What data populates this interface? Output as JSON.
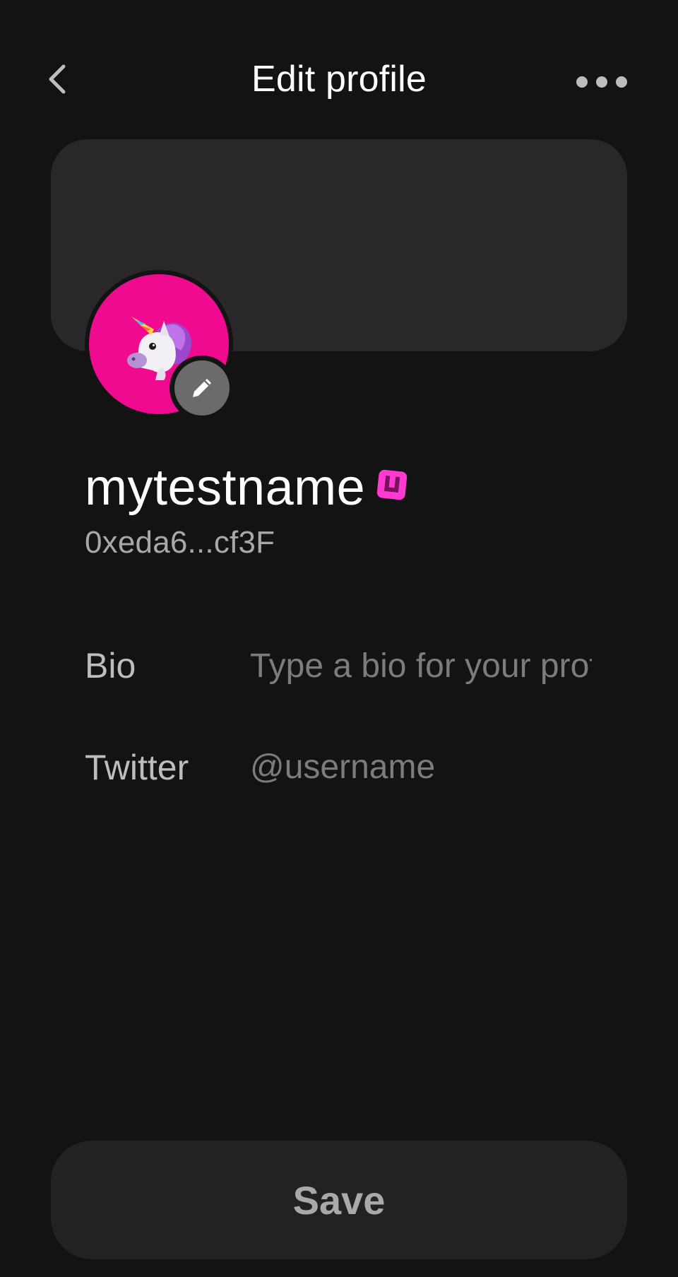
{
  "header": {
    "title": "Edit profile",
    "back_icon": "chevron-left-icon",
    "more_icon": "more-horizontal-icon"
  },
  "profile": {
    "avatar_icon": "unicorn-icon",
    "avatar_background": "#ef0a8f",
    "edit_icon": "pencil-icon",
    "username": "mytestname",
    "badge_icon": "verified-badge-icon",
    "badge_color": "#ff3ad0",
    "address": "0xeda6...cf3F"
  },
  "fields": {
    "bio": {
      "label": "Bio",
      "placeholder": "Type a bio for your profile",
      "value": ""
    },
    "twitter": {
      "label": "Twitter",
      "placeholder": "@username",
      "value": ""
    }
  },
  "actions": {
    "save_label": "Save"
  },
  "colors": {
    "background": "#131313",
    "banner": "#2a272b",
    "save_button": "#222222"
  }
}
